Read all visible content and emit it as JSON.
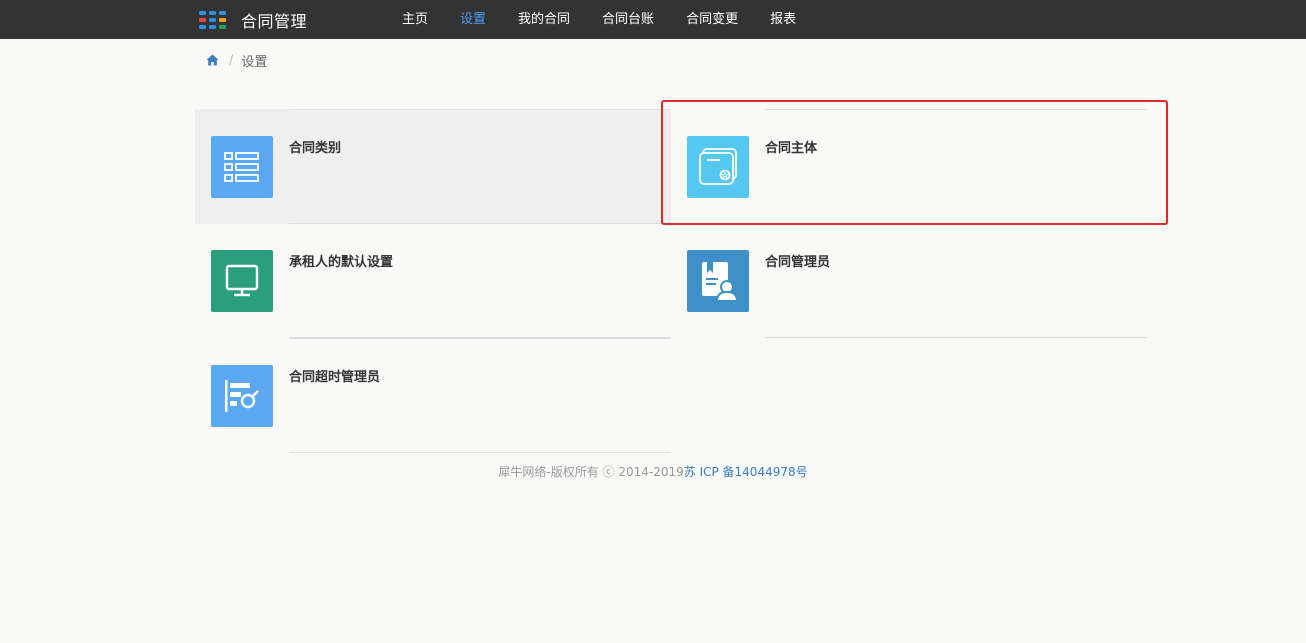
{
  "app": {
    "title": "合同管理",
    "logo_colors": [
      "#2f8fe0",
      "#2f8fe0",
      "#2f8fe0",
      "#e04848",
      "#2f8fe0",
      "#f0a020",
      "#2f8fe0",
      "#2f8fe0",
      "#22a060"
    ]
  },
  "nav": {
    "items": [
      {
        "label": "主页"
      },
      {
        "label": "设置",
        "active": true
      },
      {
        "label": "我的合同"
      },
      {
        "label": "合同台账"
      },
      {
        "label": "合同变更"
      },
      {
        "label": "报表"
      }
    ],
    "active_color": "#4c9ff2"
  },
  "breadcrumb": {
    "home_icon": "home-icon",
    "separator": "/",
    "current": "设置"
  },
  "cards": [
    {
      "label": "合同类别",
      "icon": "list-icon",
      "color": "#5aa7f2"
    },
    {
      "label": "合同主体",
      "icon": "certificate-icon",
      "color": "#55c8f2",
      "highlighted": true
    },
    {
      "label": "承租人的默认设置",
      "icon": "monitor-icon",
      "color": "#2b9e7c"
    },
    {
      "label": "合同管理员",
      "icon": "admin-badge-icon",
      "color": "#3f8fc9"
    },
    {
      "label": "合同超时管理员",
      "icon": "report-search-icon",
      "color": "#5aa7f2"
    }
  ],
  "highlight_color": "#e02828",
  "footer": {
    "copyright": "犀牛网络-版权所有 ⓒ 2014-2019",
    "icp": "苏 ICP 备14044978号"
  }
}
